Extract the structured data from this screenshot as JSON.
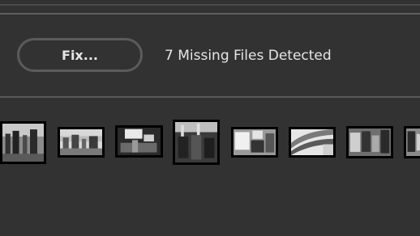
{
  "toolbar": {
    "fix_label": "Fix..."
  },
  "status": {
    "missing_files_text": "7 Missing Files Detected"
  },
  "filmstrip": {
    "thumbnails": [
      {
        "tone": "street-crowd"
      },
      {
        "tone": "city-street"
      },
      {
        "tone": "protest-signs"
      },
      {
        "tone": "crowd-raised-arms"
      },
      {
        "tone": "protest-sign-closeup"
      },
      {
        "tone": "flag-stripes"
      },
      {
        "tone": "crowd-group"
      },
      {
        "tone": "partial-thumb"
      }
    ]
  },
  "colors": {
    "background": "#323232",
    "text": "#e6e6e6",
    "button_border": "#5b5b5b",
    "thumb_border": "#000000"
  }
}
